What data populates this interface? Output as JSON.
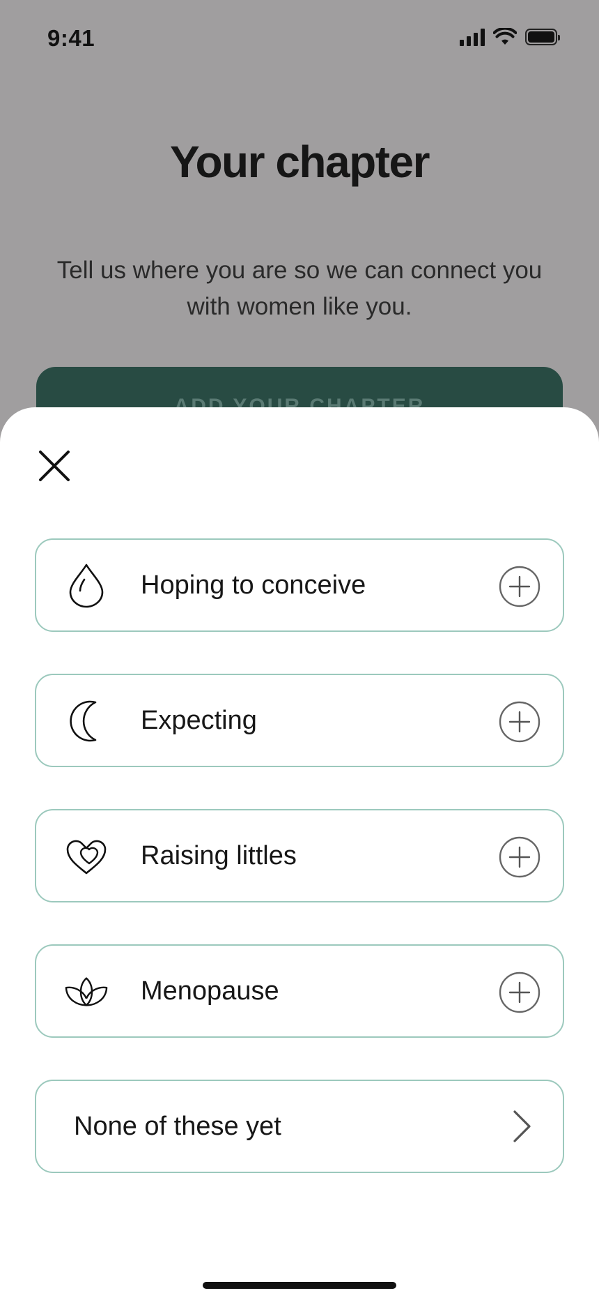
{
  "status_bar": {
    "time": "9:41"
  },
  "background_page": {
    "title": "Your chapter",
    "subtitle": "Tell us where you are so we can connect you with women like you.",
    "primary_button_label": "ADD YOUR CHAPTER"
  },
  "sheet": {
    "options": [
      {
        "label": "Hoping to conceive",
        "icon": "droplet-icon",
        "action_icon": "plus-circle-icon"
      },
      {
        "label": "Expecting",
        "icon": "crescent-moon-icon",
        "action_icon": "plus-circle-icon"
      },
      {
        "label": "Raising littles",
        "icon": "double-heart-icon",
        "action_icon": "plus-circle-icon"
      },
      {
        "label": "Menopause",
        "icon": "lotus-leaves-icon",
        "action_icon": "plus-circle-icon"
      }
    ],
    "none_option": {
      "label": "None of these yet",
      "icon": "chevron-right-icon"
    }
  },
  "colors": {
    "accent_border": "#9cc9bd",
    "button_green": "#284b43",
    "overlay": "#a09e9f"
  }
}
